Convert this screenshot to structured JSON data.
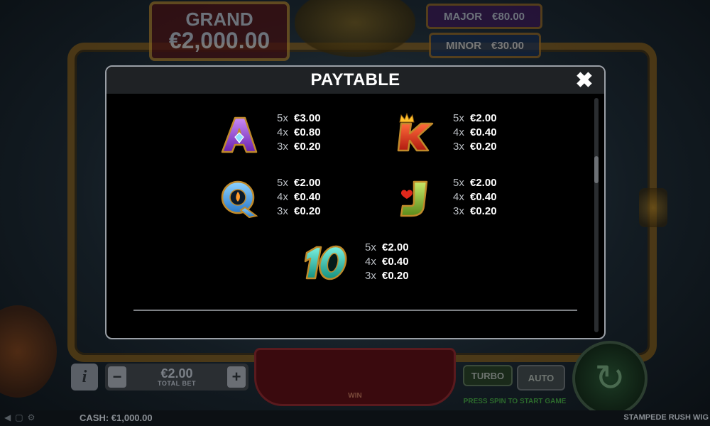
{
  "background": {
    "jackpots": {
      "grand_label": "GRAND",
      "grand_value": "€2,000.00",
      "major_label": "MAJOR",
      "major_value": "€80.00",
      "minor_label": "MINOR",
      "minor_value": "€30.00"
    },
    "controls": {
      "info_label": "i",
      "bet_value": "€2.00",
      "bet_label": "TOTAL BET",
      "bet_minus": "−",
      "bet_plus": "+",
      "win_label": "WIN",
      "turbo_label": "TURBO",
      "auto_label": "AUTO",
      "press_hint": "PRESS SPIN TO START GAME"
    },
    "status_bar": {
      "cash": "CASH: €1,000.00",
      "game_name": "STAMPEDE RUSH WIG"
    }
  },
  "paytable": {
    "title": "PAYTABLE",
    "close_icon": "close-icon",
    "symbols": [
      {
        "symbol": "A",
        "icon": "letter-a-diamond-icon",
        "color": "#9b55e0",
        "payouts": [
          {
            "count": "5x",
            "amount": "€3.00"
          },
          {
            "count": "4x",
            "amount": "€0.80"
          },
          {
            "count": "3x",
            "amount": "€0.20"
          }
        ]
      },
      {
        "symbol": "K",
        "icon": "letter-k-crown-icon",
        "color": "#e03a1c",
        "payouts": [
          {
            "count": "5x",
            "amount": "€2.00"
          },
          {
            "count": "4x",
            "amount": "€0.40"
          },
          {
            "count": "3x",
            "amount": "€0.20"
          }
        ]
      },
      {
        "symbol": "Q",
        "icon": "letter-q-flame-icon",
        "color": "#4aa6e8",
        "payouts": [
          {
            "count": "5x",
            "amount": "€2.00"
          },
          {
            "count": "4x",
            "amount": "€0.40"
          },
          {
            "count": "3x",
            "amount": "€0.20"
          }
        ]
      },
      {
        "symbol": "J",
        "icon": "letter-j-heart-icon",
        "color": "#8ab83a",
        "payouts": [
          {
            "count": "5x",
            "amount": "€2.00"
          },
          {
            "count": "4x",
            "amount": "€0.40"
          },
          {
            "count": "3x",
            "amount": "€0.20"
          }
        ]
      },
      {
        "symbol": "10",
        "icon": "number-10-icon",
        "color": "#2ec8b8",
        "payouts": [
          {
            "count": "5x",
            "amount": "€2.00"
          },
          {
            "count": "4x",
            "amount": "€0.40"
          },
          {
            "count": "3x",
            "amount": "€0.20"
          }
        ]
      }
    ]
  }
}
